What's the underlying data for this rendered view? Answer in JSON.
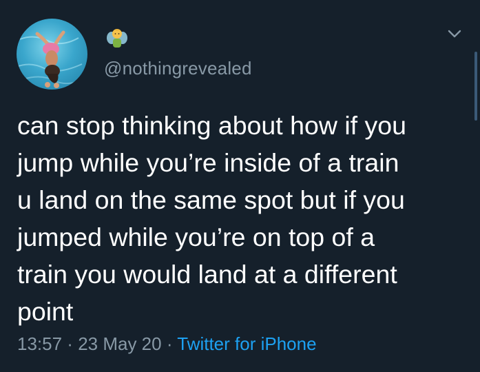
{
  "tweet": {
    "handle": "@nothingrevealed",
    "text": "can stop thinking about how if you\njump while you’re inside of a train\nu land on the same spot but if you\njumped while you’re on top of a\ntrain you would land at a different\npoint",
    "time": "13:57",
    "separator": " · ",
    "date": "23 May 20",
    "source": "Twitter for iPhone"
  },
  "icons": {
    "name_emoji": "man-fairy-emoji-icon",
    "menu": "chevron-down-icon"
  },
  "colors": {
    "background": "#15202b",
    "secondary_text": "#8899a6",
    "link": "#1da1f2"
  }
}
